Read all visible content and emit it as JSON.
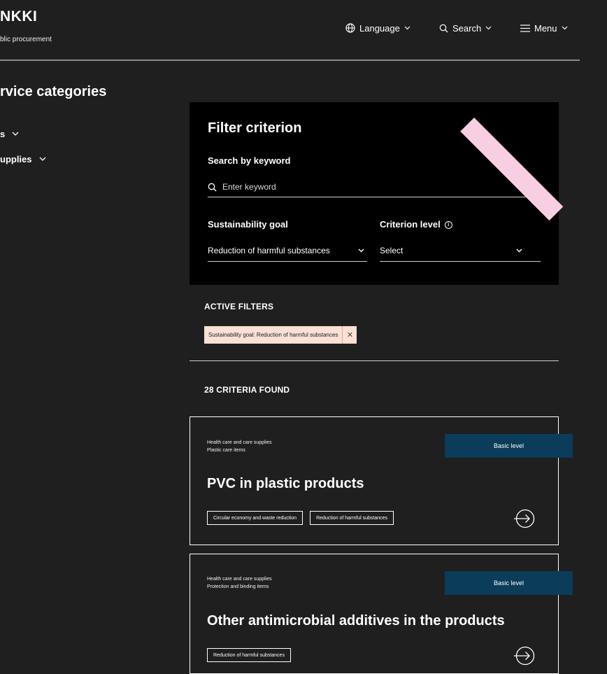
{
  "header": {
    "logo_title": "NKKI",
    "logo_sub": "blic procurement",
    "nav": {
      "language": "Language",
      "search": "Search",
      "menu": "Menu"
    }
  },
  "sidebar": {
    "title": "rvice categories",
    "items": [
      {
        "label": "s"
      },
      {
        "label": "upplies"
      }
    ]
  },
  "filter": {
    "title": "Filter criterion",
    "search_label": "Search by keyword",
    "search_placeholder": "Enter keyword",
    "goal_label": "Sustainability goal",
    "goal_value": "Reduction of harmful substances",
    "level_label": "Criterion level",
    "level_value": "Select"
  },
  "active_filters": {
    "heading": "ACTIVE FILTERS",
    "chips": [
      {
        "label": "Sustainability goal: Reduction of harmful substances"
      }
    ]
  },
  "results": {
    "count_text": "28 CRITERIA FOUND",
    "cards": [
      {
        "category": "Health care and care supplies",
        "subcategory": "Plastic care items",
        "badge": "Basic level",
        "title": "PVC in plastic products",
        "tags": [
          "Circular economy and waste reduction",
          "Reduction of harmful substances"
        ]
      },
      {
        "category": "Health care and care supplies",
        "subcategory": "Protection and binding items",
        "badge": "Basic level",
        "title": "Other antimicrobial additives in the products",
        "tags": [
          "Reduction of harmful substances"
        ]
      }
    ]
  },
  "colors": {
    "background": "#1f1f1f",
    "panel": "#000000",
    "badge": "#0b3c5a",
    "chip": "#fbe0d4",
    "accent_pink": "#f8cfe2"
  }
}
